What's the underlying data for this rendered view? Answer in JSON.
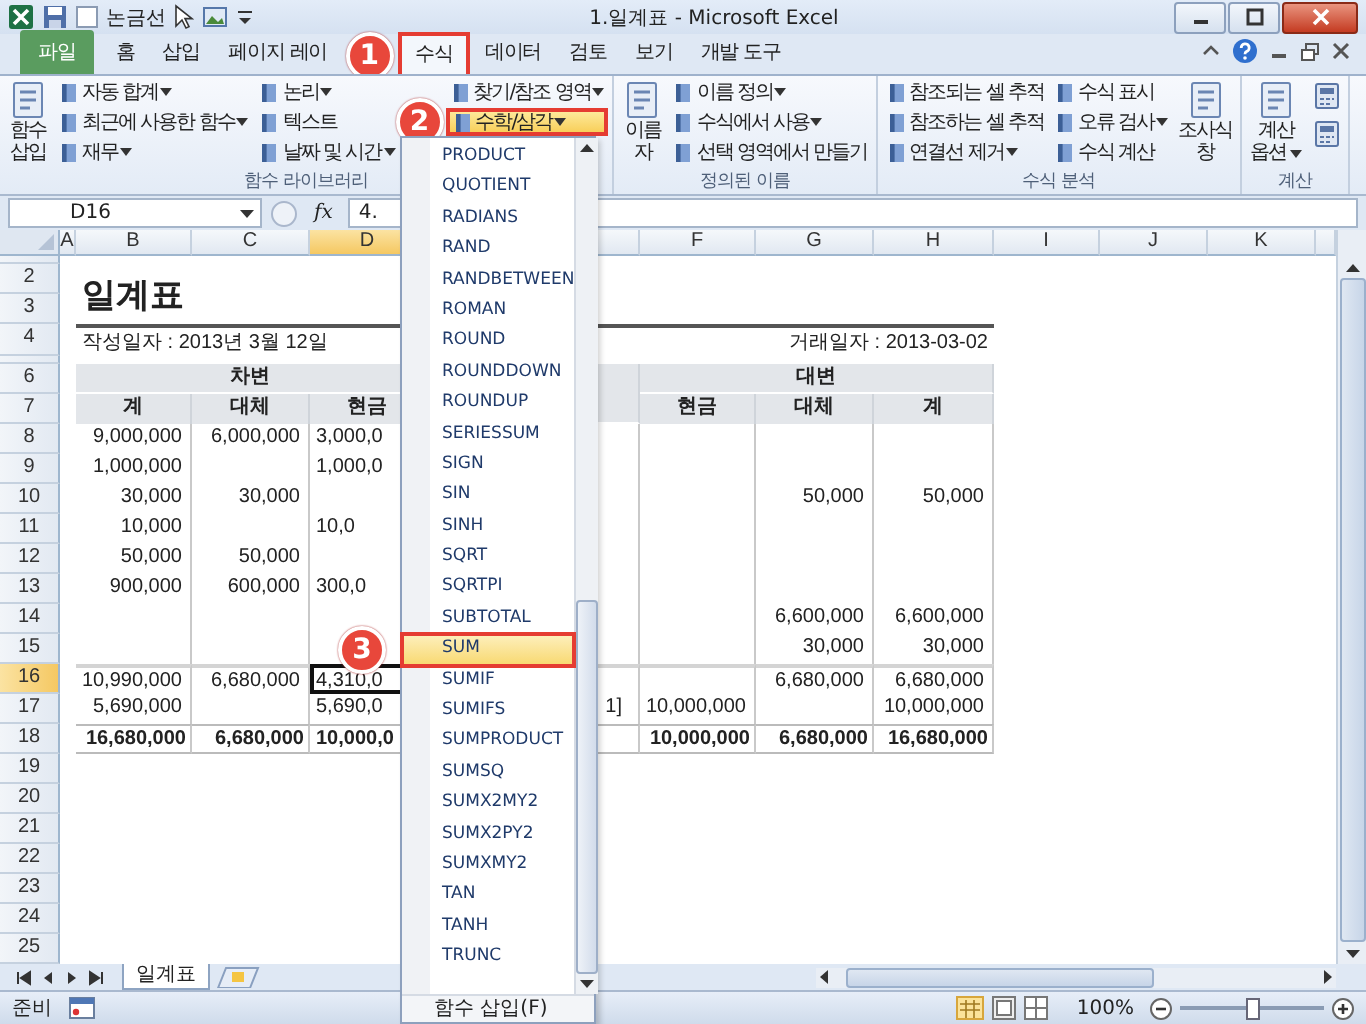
{
  "window": {
    "quick_access": {
      "label": "논금선",
      "checked": false
    },
    "title": "1.일계표 - Microsoft Excel"
  },
  "tabs": [
    {
      "label": "파일",
      "kind": "file",
      "selected": false
    },
    {
      "label": "홈",
      "kind": "tab",
      "selected": false
    },
    {
      "label": "삽입",
      "kind": "tab",
      "selected": false
    },
    {
      "label": "페이지 레이",
      "kind": "tab",
      "selected": false
    },
    {
      "label": "수식",
      "kind": "tab",
      "selected": true
    },
    {
      "label": "데이터",
      "kind": "tab",
      "selected": false
    },
    {
      "label": "검토",
      "kind": "tab",
      "selected": false
    },
    {
      "label": "보기",
      "kind": "tab",
      "selected": false
    },
    {
      "label": "개발 도구",
      "kind": "tab",
      "selected": false
    }
  ],
  "ribbon": [
    {
      "label": "함수 라이브러리",
      "columns": [
        [
          {
            "kind": "large",
            "lines": [
              "함수",
              "삽입"
            ],
            "dropdown": false,
            "selected": false
          }
        ],
        [
          {
            "kind": "small",
            "label": "자동 합계",
            "dropdown": true,
            "selected": false
          },
          {
            "kind": "small",
            "label": "최근에 사용한 함수",
            "dropdown": true,
            "selected": false
          },
          {
            "kind": "small",
            "label": "재무",
            "dropdown": true,
            "selected": false
          }
        ],
        [
          {
            "kind": "small",
            "label": "논리",
            "dropdown": true,
            "selected": false
          },
          {
            "kind": "small",
            "label": "텍스트",
            "dropdown": false,
            "selected": false
          },
          {
            "kind": "small",
            "label": "날짜 및 시간",
            "dropdown": true,
            "selected": false
          }
        ],
        [
          {
            "kind": "small",
            "label": "찾기/참조 영역",
            "dropdown": true,
            "selected": false
          },
          {
            "kind": "small",
            "label": "수학/삼각",
            "dropdown": true,
            "selected": true
          }
        ]
      ]
    },
    {
      "label": "정의된 이름",
      "columns": [
        [
          {
            "kind": "large",
            "lines": [
              "이름",
              "자"
            ],
            "dropdown": false,
            "selected": false
          }
        ],
        [
          {
            "kind": "small",
            "label": "이름 정의",
            "dropdown": true,
            "selected": false
          },
          {
            "kind": "small",
            "label": "수식에서 사용",
            "dropdown": true,
            "selected": false
          },
          {
            "kind": "small",
            "label": "선택 영역에서 만들기",
            "dropdown": false,
            "selected": false
          }
        ]
      ]
    },
    {
      "label": "수식 분석",
      "columns": [
        [
          {
            "kind": "small",
            "label": "참조되는 셀 추적",
            "dropdown": false,
            "selected": false
          },
          {
            "kind": "small",
            "label": "참조하는 셀 추적",
            "dropdown": false,
            "selected": false
          },
          {
            "kind": "small",
            "label": "연결선 제거",
            "dropdown": true,
            "selected": false
          }
        ],
        [
          {
            "kind": "small",
            "label": "수식 표시",
            "dropdown": false,
            "selected": false
          },
          {
            "kind": "small",
            "label": "오류 검사",
            "dropdown": true,
            "selected": false
          },
          {
            "kind": "small",
            "label": "수식 계산",
            "dropdown": false,
            "selected": false
          }
        ],
        [
          {
            "kind": "large",
            "lines": [
              "조사식",
              "창"
            ],
            "dropdown": false,
            "selected": false
          }
        ]
      ]
    },
    {
      "label": "계산",
      "columns": [
        [
          {
            "kind": "large",
            "lines": [
              "계산",
              "옵션"
            ],
            "dropdown": true,
            "selected": false
          }
        ],
        [
          {
            "kind": "icon",
            "selected": false
          },
          {
            "kind": "icon",
            "selected": false
          }
        ]
      ]
    }
  ],
  "formula_bar": {
    "name_box": "D16",
    "function_button": "fx",
    "formula": "4."
  },
  "columns": [
    {
      "label": "A",
      "selected": false
    },
    {
      "label": "B",
      "selected": false
    },
    {
      "label": "C",
      "selected": false
    },
    {
      "label": "D",
      "selected": true
    },
    {
      "selected": false
    },
    {
      "label": "F",
      "selected": false
    },
    {
      "label": "G",
      "selected": false
    },
    {
      "label": "H",
      "selected": false
    },
    {
      "label": "I",
      "selected": false
    },
    {
      "label": "J",
      "selected": false
    },
    {
      "label": "K",
      "selected": false
    }
  ],
  "rows": [
    {
      "kind": "thin",
      "selected": false
    },
    {
      "number": "2",
      "selected": false,
      "kind": "title",
      "text": "일계표"
    },
    {
      "number": "3",
      "selected": false,
      "kind": "blank"
    },
    {
      "number": "4",
      "selected": false,
      "kind": "dates",
      "left": "작성일자 : 2013년 3월 12일",
      "right": "거래일자 : 2013-03-02"
    },
    {
      "kind": "thin",
      "selected": false
    },
    {
      "number": "6",
      "selected": false,
      "kind": "group-header",
      "left": "차변",
      "right": "대변"
    },
    {
      "number": "7",
      "selected": false,
      "kind": "column-header",
      "cells": {
        "B": "계",
        "C": "대체",
        "D": "현금",
        "F": "현금",
        "G": "대체",
        "H": "계"
      }
    },
    {
      "number": "8",
      "selected": false,
      "kind": "data",
      "cells": {
        "B": "9,000,000",
        "C": "6,000,000",
        "D": "3,000,0"
      }
    },
    {
      "number": "9",
      "selected": false,
      "kind": "data",
      "cells": {
        "B": "1,000,000",
        "D": "1,000,0"
      }
    },
    {
      "number": "10",
      "selected": false,
      "kind": "data",
      "cells": {
        "B": "30,000",
        "C": "30,000",
        "G": "50,000",
        "H": "50,000"
      }
    },
    {
      "number": "11",
      "selected": false,
      "kind": "data",
      "cells": {
        "B": "10,000",
        "D": "10,0"
      }
    },
    {
      "number": "12",
      "selected": false,
      "kind": "data",
      "cells": {
        "B": "50,000",
        "C": "50,000"
      }
    },
    {
      "number": "13",
      "selected": false,
      "kind": "data",
      "cells": {
        "B": "900,000",
        "C": "600,000",
        "D": "300,0"
      }
    },
    {
      "number": "14",
      "selected": false,
      "kind": "data",
      "cells": {
        "G": "6,600,000",
        "H": "6,600,000"
      }
    },
    {
      "number": "15",
      "selected": false,
      "kind": "data",
      "cells": {
        "G": "30,000",
        "H": "30,000"
      }
    },
    {
      "number": "16",
      "selected": true,
      "kind": "subtotal",
      "cells": {
        "B": "10,990,000",
        "C": "6,680,000",
        "D": "4,310,0",
        "G": "6,680,000",
        "H": "6,680,000"
      }
    },
    {
      "number": "17",
      "selected": false,
      "kind": "data",
      "cells": {
        "B": "5,690,000",
        "D": "5,690,0",
        "E": "1]",
        "F": "10,000,000",
        "H": "10,000,000"
      }
    },
    {
      "number": "18",
      "selected": false,
      "kind": "total",
      "cells": {
        "B": "16,680,000",
        "C": "6,680,000",
        "D": "10,000,0",
        "F": "10,000,000",
        "G": "6,680,000",
        "H": "16,680,000"
      }
    },
    {
      "number": "19",
      "selected": false,
      "kind": "blank"
    },
    {
      "number": "20",
      "selected": false,
      "kind": "blank"
    },
    {
      "number": "21",
      "selected": false,
      "kind": "blank"
    },
    {
      "number": "22",
      "selected": false,
      "kind": "blank"
    },
    {
      "number": "23",
      "selected": false,
      "kind": "blank"
    },
    {
      "number": "24",
      "selected": false,
      "kind": "blank"
    },
    {
      "number": "25",
      "selected": false,
      "kind": "blank"
    }
  ],
  "math_menu": {
    "items": [
      {
        "label": "PRODUCT",
        "selected": false
      },
      {
        "label": "QUOTIENT",
        "selected": false
      },
      {
        "label": "RADIANS",
        "selected": false
      },
      {
        "label": "RAND",
        "selected": false
      },
      {
        "label": "RANDBETWEEN",
        "selected": false
      },
      {
        "label": "ROMAN",
        "selected": false
      },
      {
        "label": "ROUND",
        "selected": false
      },
      {
        "label": "ROUNDDOWN",
        "selected": false
      },
      {
        "label": "ROUNDUP",
        "selected": false
      },
      {
        "label": "SERIESSUM",
        "selected": false
      },
      {
        "label": "SIGN",
        "selected": false
      },
      {
        "label": "SIN",
        "selected": false
      },
      {
        "label": "SINH",
        "selected": false
      },
      {
        "label": "SQRT",
        "selected": false
      },
      {
        "label": "SQRTPI",
        "selected": false
      },
      {
        "label": "SUBTOTAL",
        "selected": false
      },
      {
        "label": "SUM",
        "selected": true
      },
      {
        "label": "SUMIF",
        "selected": false
      },
      {
        "label": "SUMIFS",
        "selected": false
      },
      {
        "label": "SUMPRODUCT",
        "selected": false
      },
      {
        "label": "SUMSQ",
        "selected": false
      },
      {
        "label": "SUMX2MY2",
        "selected": false
      },
      {
        "label": "SUMX2PY2",
        "selected": false
      },
      {
        "label": "SUMXMY2",
        "selected": false
      },
      {
        "label": "TAN",
        "selected": false
      },
      {
        "label": "TANH",
        "selected": false
      },
      {
        "label": "TRUNC",
        "selected": false
      }
    ],
    "footer": "함수 삽입(F)"
  },
  "sheet_tabs": [
    {
      "label": "일계표",
      "selected": true
    }
  ],
  "status_bar": {
    "mode": "준비",
    "zoom": "100%",
    "zoom_slider": {
      "level": 0.5
    }
  },
  "callouts": [
    {
      "number": "1"
    },
    {
      "number": "2"
    },
    {
      "number": "3"
    }
  ]
}
